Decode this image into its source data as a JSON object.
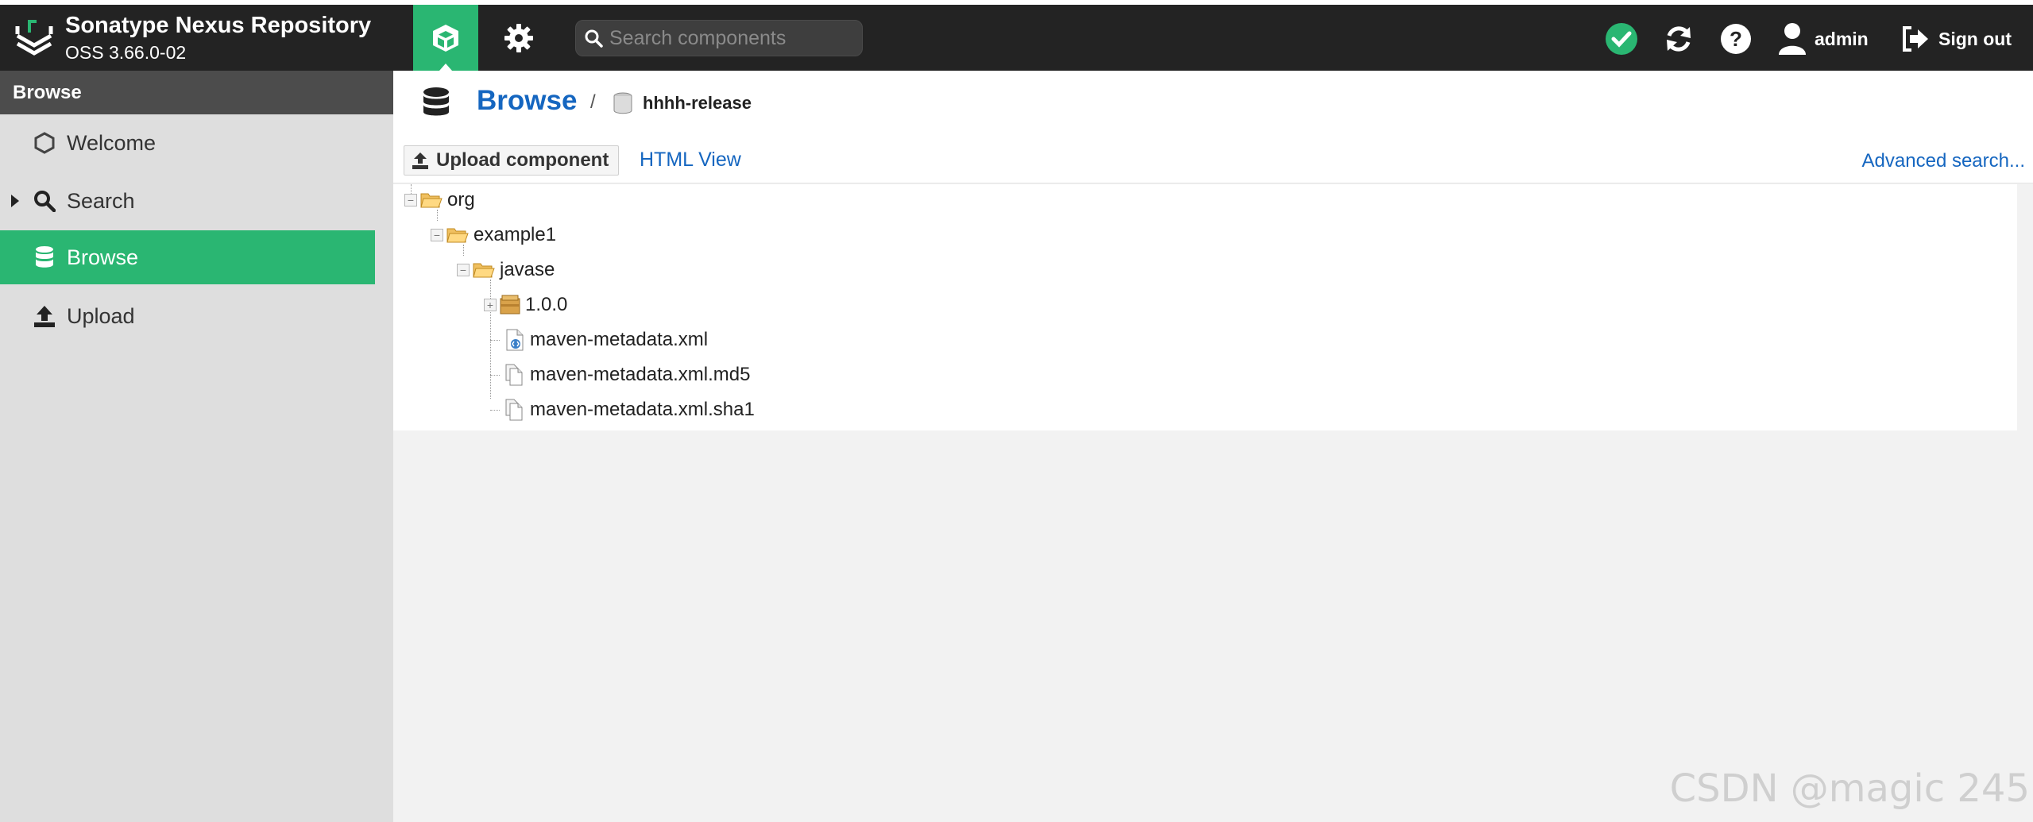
{
  "header": {
    "brand_title": "Sonatype Nexus Repository",
    "brand_version": "OSS 3.66.0-02",
    "search_placeholder": "Search components",
    "user_label": "admin",
    "signout_label": "Sign out"
  },
  "sidebar": {
    "title": "Browse",
    "items": [
      {
        "label": "Welcome"
      },
      {
        "label": "Search"
      },
      {
        "label": "Browse"
      },
      {
        "label": "Upload"
      }
    ]
  },
  "main": {
    "breadcrumb_title": "Browse",
    "breadcrumb_separator": "/",
    "repository": "hhhh-release",
    "upload_label": "Upload component",
    "html_view_label": "HTML View",
    "advanced_search_label": "Advanced search...",
    "tree": [
      {
        "label": "org",
        "kind": "folder-open"
      },
      {
        "label": "example1",
        "kind": "folder-open"
      },
      {
        "label": "javase",
        "kind": "folder-open"
      },
      {
        "label": "1.0.0",
        "kind": "component"
      },
      {
        "label": "maven-metadata.xml",
        "kind": "xml-file"
      },
      {
        "label": "maven-metadata.xml.md5",
        "kind": "file"
      },
      {
        "label": "maven-metadata.xml.sha1",
        "kind": "file"
      }
    ]
  },
  "watermark": "CSDN @magic 245",
  "colors": {
    "accent": "#2ab672",
    "header_bg": "#232323",
    "link": "#1566c0"
  }
}
